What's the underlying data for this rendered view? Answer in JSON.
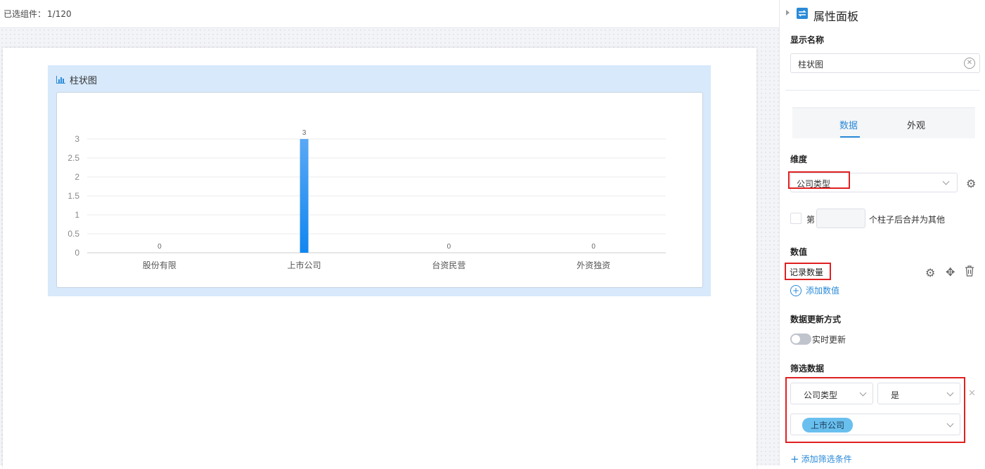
{
  "header": {
    "selected_label": "已选组件：",
    "selected_count": "1/120"
  },
  "widget": {
    "title": "柱状图"
  },
  "chart_data": {
    "type": "bar",
    "categories": [
      "股份有限",
      "上市公司",
      "台资民营",
      "外资独资"
    ],
    "values": [
      0,
      3,
      0,
      0
    ],
    "ylim": [
      0,
      3
    ],
    "yticks": [
      "0",
      "0.5",
      "1",
      "1.5",
      "2",
      "2.5",
      "3"
    ],
    "grid": true,
    "bar_color": "#1890ff"
  },
  "panel": {
    "title": "属性面板",
    "display_name_label": "显示名称",
    "display_name_value": "柱状图",
    "tabs": [
      "数据",
      "外观"
    ],
    "dimension_label": "维度",
    "dimension_value": "公司类型",
    "merge_prefix": "第",
    "merge_suffix": "个柱子后合并为其他",
    "value_label": "数值",
    "value_item": "记录数量",
    "add_value": "添加数值",
    "update_label": "数据更新方式",
    "update_toggle": "实时更新",
    "filter_label": "筛选数据",
    "filter_field": "公司类型",
    "filter_op": "是",
    "filter_tag": "上市公司",
    "add_filter": "添加筛选条件"
  },
  "colors": {
    "accent": "#2a8ad8",
    "highlight": "#e02020"
  }
}
